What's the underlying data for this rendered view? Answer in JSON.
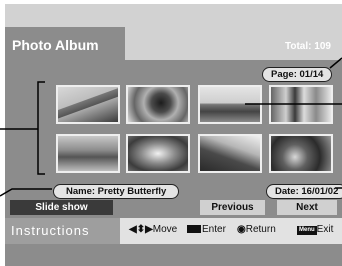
{
  "header": {
    "title": "Photo Album",
    "total": "Total: 109"
  },
  "page_indicator": "Page: 01/14",
  "thumbnails": [
    {
      "id": "thumb-1"
    },
    {
      "id": "thumb-2"
    },
    {
      "id": "thumb-3"
    },
    {
      "id": "thumb-4"
    },
    {
      "id": "thumb-5"
    },
    {
      "id": "thumb-6"
    },
    {
      "id": "thumb-7"
    },
    {
      "id": "thumb-8"
    }
  ],
  "photo_info": {
    "name": "Name: Pretty Butterfly",
    "date": "Date: 16/01/02"
  },
  "buttons": {
    "slideshow": "Slide show",
    "previous": "Previous",
    "next": "Next"
  },
  "instructions": {
    "label": "Instructions",
    "move_glyph": "◀⬍▶",
    "move": "Move",
    "enter": "Enter",
    "return_glyph": "◉",
    "return": "Return",
    "menu_key": "Menu",
    "exit": "Exit"
  },
  "colors": {
    "background": "#8c8c8c",
    "header": "#d2d2d2",
    "instructions_band": "#e2e2e2"
  }
}
